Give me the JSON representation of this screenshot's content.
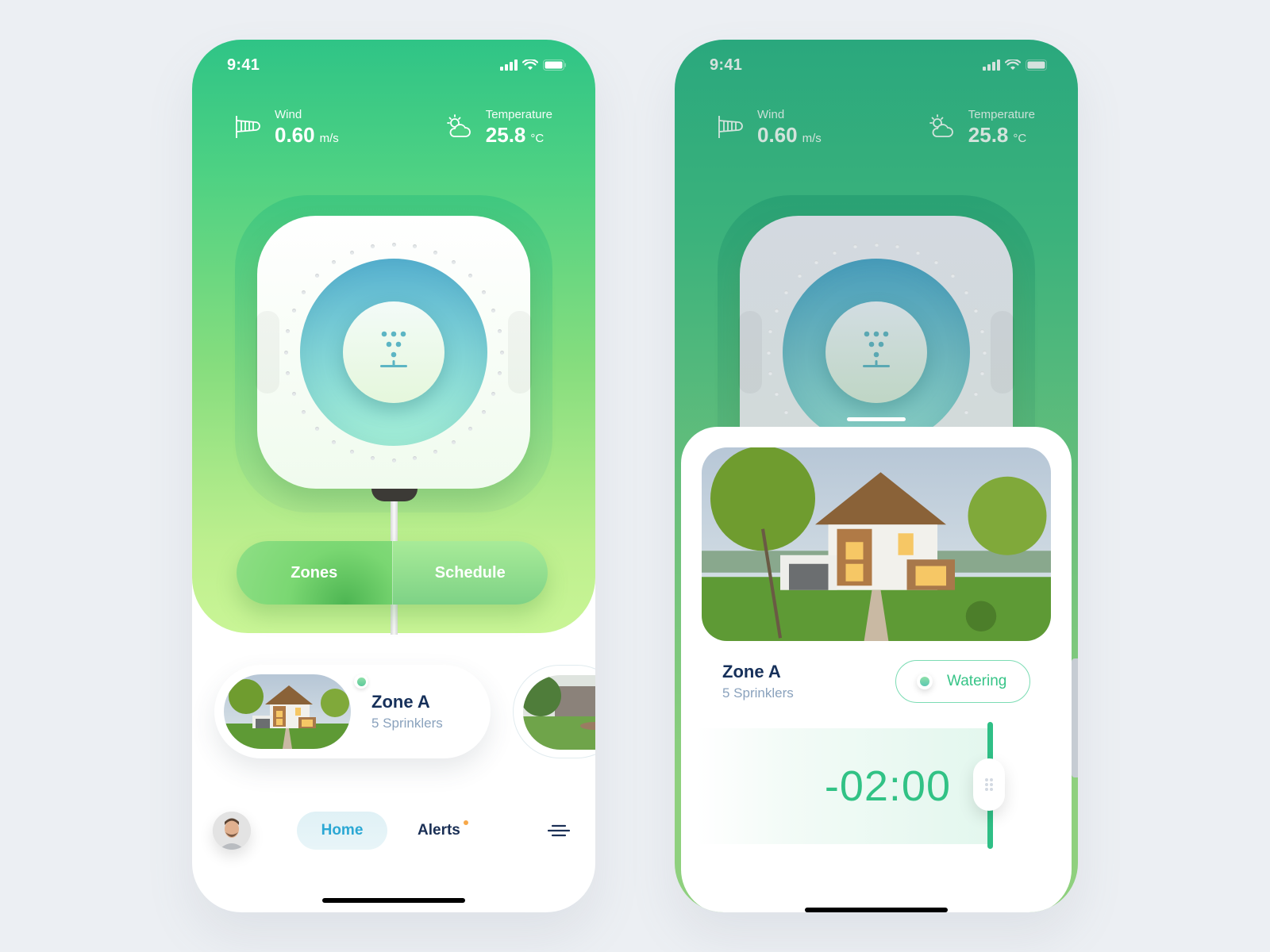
{
  "screens": {
    "home": {
      "status_bar": {
        "time": "9:41",
        "icons": [
          "signal-icon",
          "wifi-icon",
          "battery-icon"
        ]
      },
      "weather": {
        "wind": {
          "label": "Wind",
          "value": "0.60",
          "unit": "m/s",
          "icon": "windsock-icon"
        },
        "temperature": {
          "label": "Temperature",
          "value": "25.8",
          "unit": "°C",
          "icon": "sun-cloud-icon"
        }
      },
      "device": {
        "icon": "sprinkler-icon"
      },
      "segmented": {
        "zones": "Zones",
        "schedule": "Schedule"
      },
      "zones": [
        {
          "name": "Zone A",
          "sprinklers": "5 Sprinklers",
          "online": true
        },
        {
          "name": "",
          "sprinklers": ""
        }
      ],
      "nav": {
        "home": "Home",
        "alerts": "Alerts",
        "alerts_has_badge": true,
        "menu_icon": "menu-icon"
      }
    },
    "zone_detail": {
      "status_bar": {
        "time": "9:41"
      },
      "weather": {
        "wind": {
          "label": "Wind",
          "value": "0.60",
          "unit": "m/s"
        },
        "temperature": {
          "label": "Temperature",
          "value": "25.8",
          "unit": "°C"
        }
      },
      "zone": {
        "name": "Zone A",
        "sprinklers": "5 Sprinklers"
      },
      "status_button": "Watering",
      "timer": "-02:00"
    }
  },
  "colors": {
    "brand_green": "#2fbf86",
    "navy": "#16305a",
    "muted_blue": "#8aa2bd",
    "home_tab": "#2ba8d4",
    "alert_dot": "#f7a849"
  }
}
